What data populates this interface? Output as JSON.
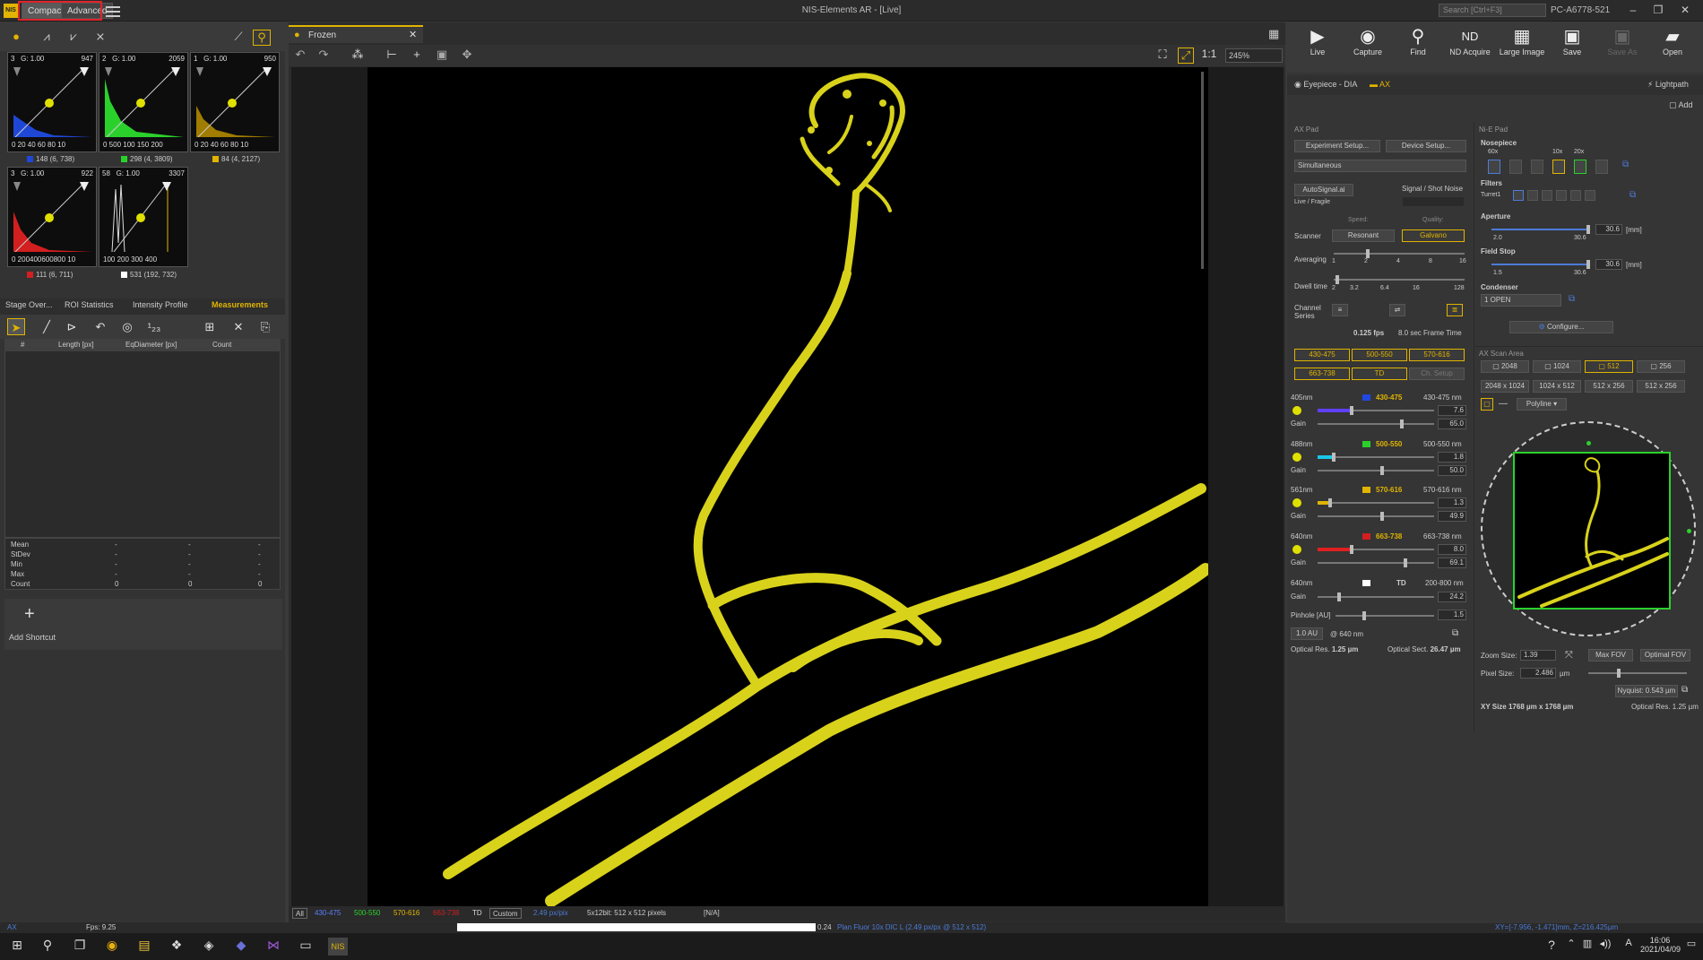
{
  "window": {
    "title": "NIS-Elements AR  - [Live]",
    "search_placeholder": "Search [Ctrl+F3]",
    "user": "PC-A6778-521"
  },
  "modes": {
    "compact": "Compact",
    "advanced": "Advanced"
  },
  "histograms": [
    {
      "id": "3",
      "gain": "G: 1.00",
      "max": "947",
      "axis": "0  20  40  60  80  10",
      "legend": "148 (6, 738)",
      "color": "#1f47d6"
    },
    {
      "id": "2",
      "gain": "G: 1.00",
      "max": "2059",
      "axis": "0  500 100 150 200",
      "legend": "298 (4, 3809)",
      "color": "#2bd12b"
    },
    {
      "id": "1",
      "gain": "G: 1.00",
      "max": "950",
      "axis": "0  20  40  60  80  10",
      "legend": "84 (4, 2127)",
      "color": "#e0b400"
    },
    {
      "id": "3",
      "gain": "G: 1.00",
      "max": "922",
      "axis": "0  200400600800 10",
      "legend": "111 (6, 711)",
      "color": "#d21f1f"
    },
    {
      "id": "58",
      "gain": "G: 1.00",
      "max": "3307",
      "axis": "100  200  300  400",
      "legend": "531 (192, 732)",
      "color": "#ffffff"
    }
  ],
  "meas_tabs": [
    "Stage Over...",
    "ROI Statistics",
    "Intensity Profile",
    "Measurements"
  ],
  "meas_columns": [
    "#",
    "Length [px]",
    "EqDiameter [px]",
    "Count"
  ],
  "stats": {
    "labels": [
      "Mean",
      "StDev",
      "Min",
      "Max",
      "Count"
    ],
    "values": [
      [
        "-",
        "-",
        "-"
      ],
      [
        "-",
        "-",
        "-"
      ],
      [
        "-",
        "-",
        "-"
      ],
      [
        "-",
        "-",
        "-"
      ],
      [
        "0",
        "0",
        "0"
      ]
    ]
  },
  "shortcut": {
    "label": "Add Shortcut"
  },
  "document": {
    "tab": "Frozen",
    "zoom": "245%",
    "ratio": "1:1"
  },
  "bottom_channels": [
    "All",
    "430-475",
    "500-550",
    "570-616",
    "663-738",
    "TD",
    "Custom"
  ],
  "bottom_info": {
    "pxsize": "2.49 px/pix",
    "bits": "5x12bit: 512 x 512 pixels",
    "na": "[N/A]"
  },
  "status": {
    "left": "AX",
    "fps": "Fps: 9.25",
    "progress": "0.24",
    "objective": "Plan Fluor 10x DIC L (2.49 px/px @ 512 x 512)",
    "coords": "XY=[-7.956, -1.471]mm, Z=216.425µm"
  },
  "clock": {
    "time": "16:06",
    "date": "2021/04/09"
  },
  "acq_buttons": [
    "Live",
    "Capture",
    "Find",
    "ND Acquire",
    "Large Image",
    "Save",
    "Save As",
    "Open"
  ],
  "tabs": {
    "eyepiece": "Eyepiece - DIA",
    "ax": "AX",
    "lightpath": "Lightpath",
    "add": "Add"
  },
  "axpad": {
    "title": "AX Pad",
    "experiment": "Experiment Setup...",
    "device": "Device Setup...",
    "mode": "Simultaneous",
    "autosignal": "AutoSignal.ai",
    "live_fragile": "Live / Fragile",
    "signal_noise": "Signal / Shot Noise",
    "speed": "Speed:",
    "quality": "Quality:",
    "scanner": "Scanner",
    "resonant": "Resonant",
    "galvano": "Galvano",
    "averaging": "Averaging",
    "avg_ticks": [
      "1",
      "2",
      "4",
      "8",
      "16"
    ],
    "dwell": "Dwell time",
    "dwell_ticks": [
      "2",
      "3.2",
      "6.4",
      "16",
      "128"
    ],
    "channel_series": "Channel Series",
    "fps": "0.125 fps",
    "frame_time": "8.0 sec Frame Time",
    "channels": [
      "430-475",
      "500-550",
      "570-616",
      "663-738",
      "TD",
      "Ch. Setup"
    ],
    "lasers": [
      {
        "line": "405nm",
        "name": "430-475",
        "range": "430-475 nm",
        "power": "7.6",
        "gain": "65.0",
        "color": "#6040ff"
      },
      {
        "line": "488nm",
        "name": "500-550",
        "range": "500-550 nm",
        "power": "1.8",
        "gain": "50.0",
        "color": "#19c7e8"
      },
      {
        "line": "561nm",
        "name": "570-616",
        "range": "570-616 nm",
        "power": "1.3",
        "gain": "49.9",
        "color": "#e0b400"
      },
      {
        "line": "640nm",
        "name": "663-738",
        "range": "663-738 nm",
        "power": "8.0",
        "gain": "69.1",
        "color": "#e02020"
      }
    ],
    "td": {
      "line": "640nm",
      "name": "TD",
      "range": "200-800 nm",
      "gain": "24.2"
    },
    "gain_label": "Gain",
    "pinhole": "Pinhole [AU]",
    "pinhole_val": "1.5",
    "au_btn": "1.0 AU",
    "at640": "@ 640 nm",
    "optical_res": "Optical Res.",
    "optical_res_val": "1.25 µm",
    "optical_sect": "Optical Sect.",
    "optical_sect_val": "26.47 µm"
  },
  "nipad": {
    "title": "Ni-E Pad",
    "nosepiece": "Nosepiece",
    "mags": [
      "60x",
      "10x",
      "20x"
    ],
    "filters": "Filters",
    "turret": "Turret1",
    "aperture": "Aperture",
    "aperture_val": "30.6",
    "aperture_min": "2.0",
    "aperture_max": "30.6",
    "fieldstop": "Field Stop",
    "fieldstop_val": "30.6",
    "fieldstop_min": "1.5",
    "fieldstop_max": "30.6",
    "unit_mm": "[mm]",
    "condenser": "Condenser",
    "condenser_val": "1 OPEN",
    "configure": "Configure..."
  },
  "scan": {
    "title": "AX Scan Area",
    "sizes": [
      "2048",
      "1024",
      "512",
      "256"
    ],
    "rects": [
      "2048 x 1024",
      "1024 x 512",
      "512 x 256",
      "512 x 256"
    ],
    "polyline": "Polyline",
    "zoom_label": "Zoom Size:",
    "zoom_val": "1.39",
    "max_fov": "Max FOV",
    "optimal_fov": "Optimal FOV",
    "pixel_label": "Pixel Size:",
    "pixel_val": "2.486",
    "um": "µm",
    "nyquist": "Nyquist: 0.543 µm",
    "xy_size": "XY Size 1768 µm x 1768 µm",
    "optical_res": "Optical Res. 1.25 µm"
  }
}
